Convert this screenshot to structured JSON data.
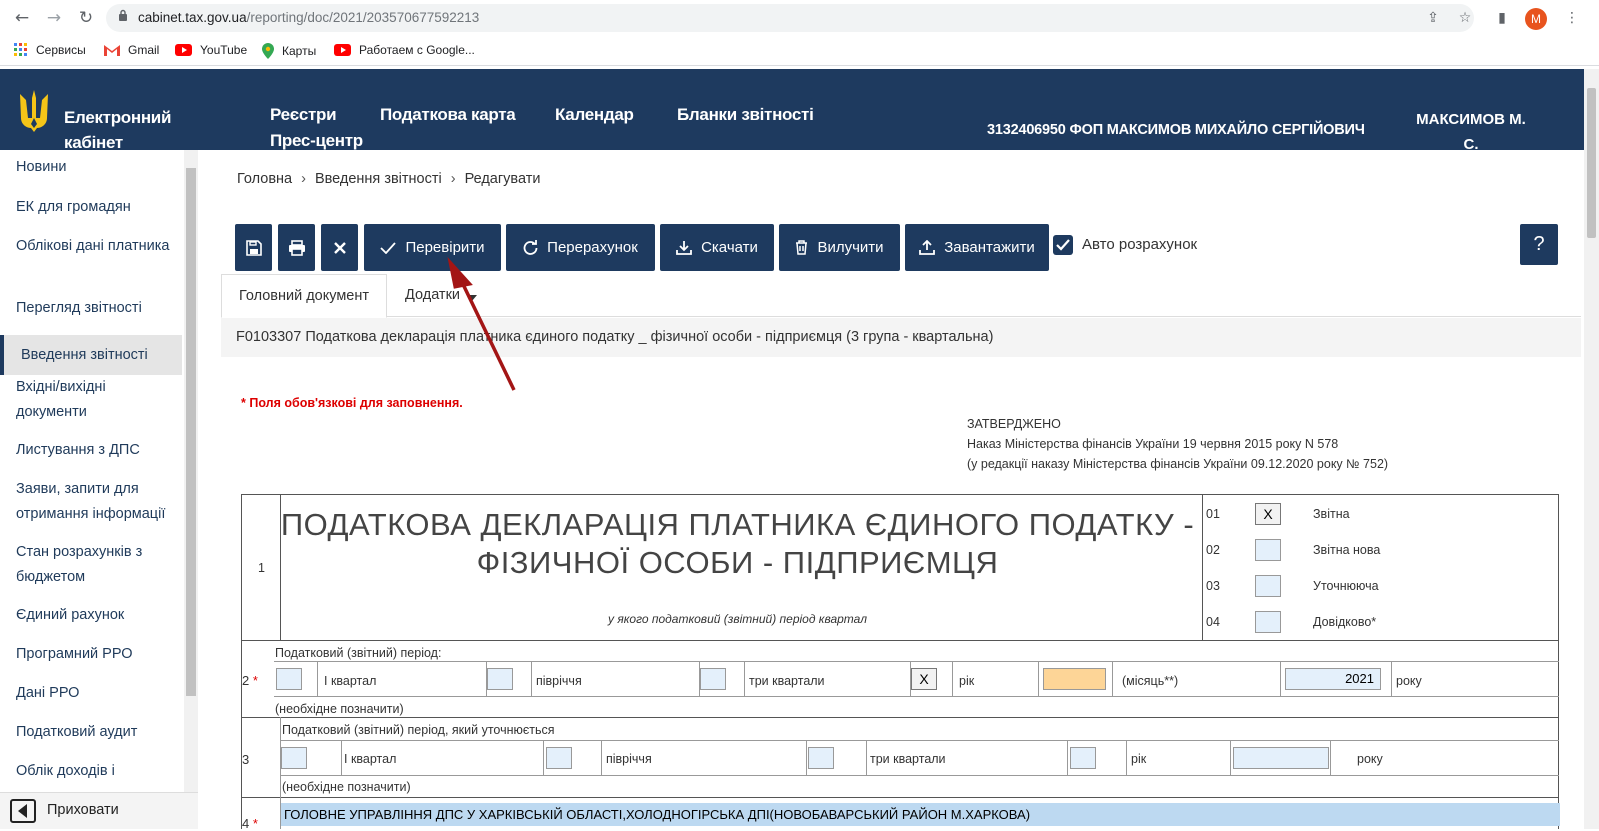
{
  "browser": {
    "url_host": "cabinet.tax.gov.ua",
    "url_path": "/reporting/doc/2021/203570677592213",
    "avatar_letter": "M",
    "bookmarks": [
      "Сервисы",
      "Gmail",
      "YouTube",
      "Карты",
      "Работаем с Google..."
    ]
  },
  "header": {
    "logo_text": "Електронний кабінет",
    "nav": [
      "Реєстри",
      "Податкова карта",
      "Календар",
      "Бланки звітності",
      "Прес-центр"
    ],
    "user_info": "3132406950 ФОП МАКСИМОВ МИХАЙЛО СЕРГІЙОВИЧ",
    "user_short": "МАКСИМОВ М. С."
  },
  "sidebar": {
    "items": [
      "Новини",
      "ЕК для громадян",
      "Облікові дані платника",
      "Перегляд звітності",
      "Введення звітності",
      "Вхідні/вихідні документи",
      "Листування з ДПС",
      "Заяви, запити для отримання інформації",
      "Стан розрахунків з бюджетом",
      "Єдиний рахунок",
      "Програмний РРО",
      "Дані РРО",
      "Податковий аудит",
      "Облік доходів і"
    ],
    "active_index": 4,
    "hide_label": "Приховати"
  },
  "breadcrumb": [
    "Головна",
    "Введення звітності",
    "Редагувати"
  ],
  "toolbar": {
    "check_label": "Перевірити",
    "recalc_label": "Перерахунок",
    "download_label": "Скачати",
    "delete_label": "Вилучити",
    "upload_label": "Завантажити",
    "auto_calc_label": "Авто розрахунок",
    "auto_calc_checked": true,
    "help_label": "?"
  },
  "tabs": {
    "main_doc": "Головний документ",
    "attachments": "Додатки"
  },
  "document": {
    "title": "F0103307 Податкова декларація платника єдиного податку _ фізичної особи - підприємця (3 група - квартальна)",
    "required_note": "* Поля обов'язкові для заповнення.",
    "approved_1": "ЗАТВЕРДЖЕНО",
    "approved_2": "Наказ Міністерства фінансів України 19 червня 2015 року N 578",
    "approved_3": "(у редакції наказу Міністерства фінансів України 09.12.2020 року № 752)",
    "big_title": "ПОДАТКОВА ДЕКЛАРАЦІЯ ПЛАТНИКА ЄДИНОГО ПОДАТКУ - ФІЗИЧНОЇ ОСОБИ - ПІДПРИЄМЦЯ",
    "subtitle": "у якого податковий (звітний) період квартал",
    "row1_num": "1",
    "types": [
      {
        "code": "01",
        "label": "Звітна",
        "mark": "X"
      },
      {
        "code": "02",
        "label": "Звітна нова",
        "mark": ""
      },
      {
        "code": "03",
        "label": "Уточнююча",
        "mark": ""
      },
      {
        "code": "04",
        "label": "Довідково*",
        "mark": ""
      }
    ],
    "row2": {
      "num": "2",
      "star": "*",
      "caption": "Податковий (звітний) період:",
      "q1": "I квартал",
      "half": "півріччя",
      "q3": "три квартали",
      "year_mark": "X",
      "year": "рік",
      "month": "(місяць**)",
      "year_value": "2021",
      "year_suffix": "року",
      "note": "(необхідне позначити)"
    },
    "row3": {
      "num": "3",
      "caption": "Податковий (звітний) період, який уточнюється",
      "q1": "I квартал",
      "half": "півріччя",
      "q3": "три квартали",
      "year": "рік",
      "year_suffix": "року",
      "note": "(необхідне позначити)"
    },
    "row4": {
      "num": "4",
      "star": "*",
      "authority": "ГОЛОВНЕ УПРАВЛІННЯ ДПС У ХАРКІВСЬКІЙ ОБЛАСТІ,ХОЛОДНОГІРСЬКА ДПІ(НОВОБАВАРСЬКИЙ РАЙОН М.ХАРКОВА)"
    }
  }
}
